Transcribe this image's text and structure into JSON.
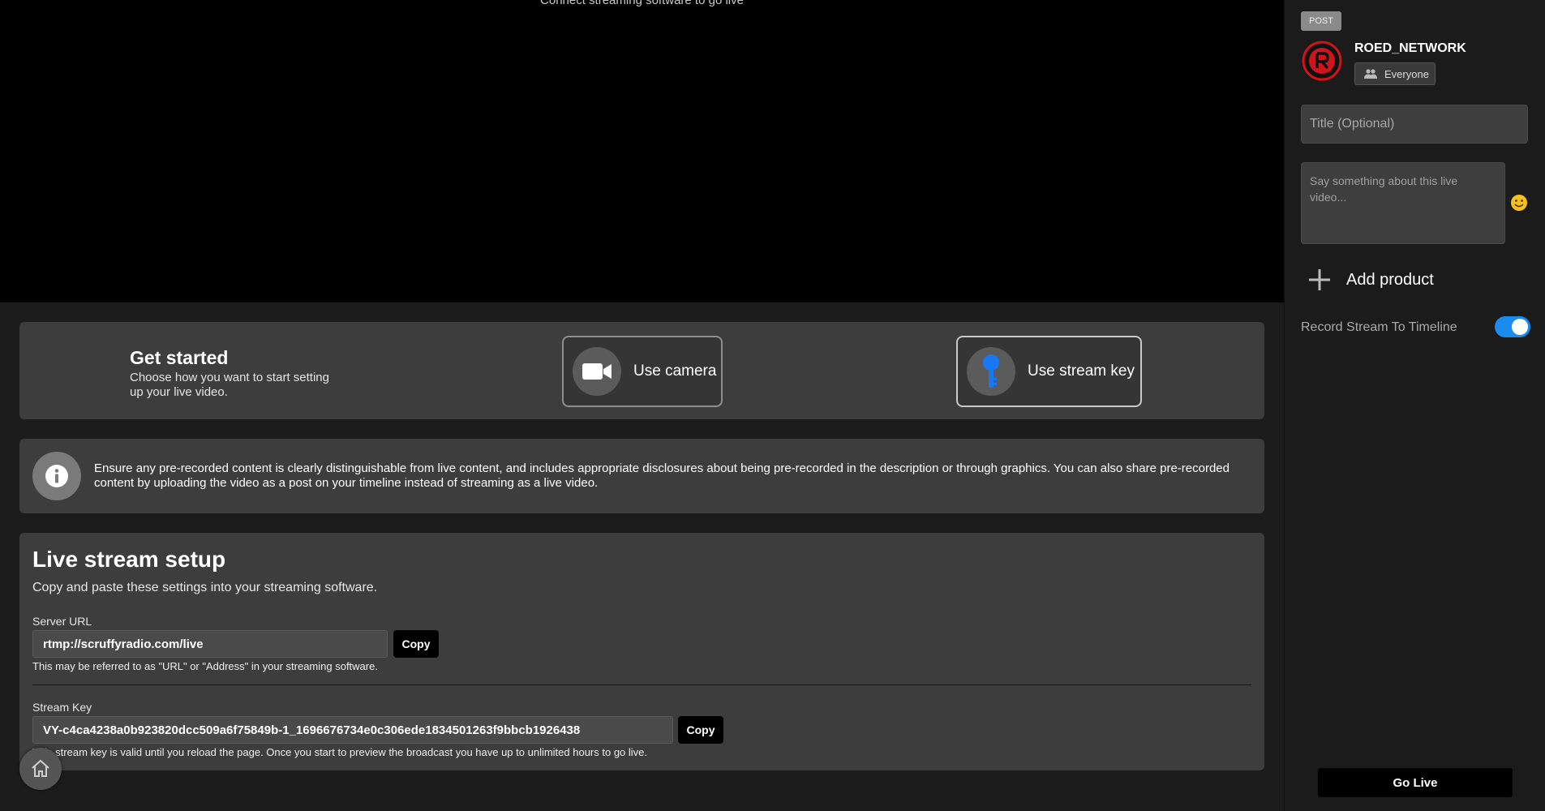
{
  "preview": {
    "message": "Connect streaming software to go live"
  },
  "get_started": {
    "title": "Get started",
    "subtitle": "Choose how you want to start setting up your live video.",
    "options": [
      {
        "label": "Use camera",
        "icon": "video-camera-icon"
      },
      {
        "label": "Use stream key",
        "icon": "key-icon"
      }
    ]
  },
  "info": {
    "icon": "info-icon",
    "text": "Ensure any pre-recorded content is clearly distinguishable from live content, and includes appropriate disclosures about being pre-recorded in the description or through graphics. You can also share pre-recorded content by uploading the video as a post on your timeline instead of streaming as a live video."
  },
  "setup": {
    "title": "Live stream setup",
    "subtitle": "Copy and paste these settings into your streaming software.",
    "server_url": {
      "label": "Server URL",
      "value": "rtmp://scruffyradio.com/live",
      "copy_label": "Copy",
      "help": "This may be referred to as \"URL\" or \"Address\" in your streaming software."
    },
    "stream_key": {
      "label": "Stream Key",
      "value": "VY-c4ca4238a0b923820dcc509a6f75849b-1_1696676734e0c306ede1834501263f9bbcb1926438",
      "copy_label": "Copy",
      "help": "This stream key is valid until you reload the page. Once you start to preview the broadcast you have up to unlimited hours to go live."
    }
  },
  "sidebar": {
    "badge": "POST",
    "profile_name": "ROED_NETWORK",
    "audience": "Everyone",
    "title_placeholder": "Title (Optional)",
    "description_placeholder": "Say something about this live video...",
    "add_product_label": "Add product",
    "record_label": "Record Stream To Timeline",
    "record_enabled": true,
    "go_live_label": "Go Live"
  },
  "colors": {
    "accent": "#1a8cf0",
    "key_icon": "#1877f2",
    "avatar_red": "#d0141c",
    "emoji_yellow": "#f7c21b"
  }
}
